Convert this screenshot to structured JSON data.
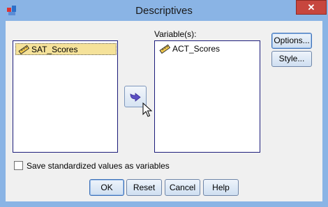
{
  "window": {
    "title": "Descriptives",
    "close_label": "✕"
  },
  "source_list": {
    "items": [
      {
        "label": "SAT_Scores",
        "selected": true
      }
    ]
  },
  "target_list": {
    "header": "Variable(s):",
    "items": [
      {
        "label": "ACT_Scores",
        "selected": false
      }
    ]
  },
  "side_buttons": {
    "options": "Options...",
    "style": "Style..."
  },
  "checkbox": {
    "label": "Save standardized values as variables",
    "checked": false
  },
  "bottom_buttons": {
    "ok": "OK",
    "reset": "Reset",
    "cancel": "Cancel",
    "help": "Help"
  },
  "icons": {
    "app": "spss-app-icon",
    "variable": "scale-ruler-icon",
    "move": "move-right-arrow-icon",
    "cursor": "mouse-pointer-icon"
  }
}
